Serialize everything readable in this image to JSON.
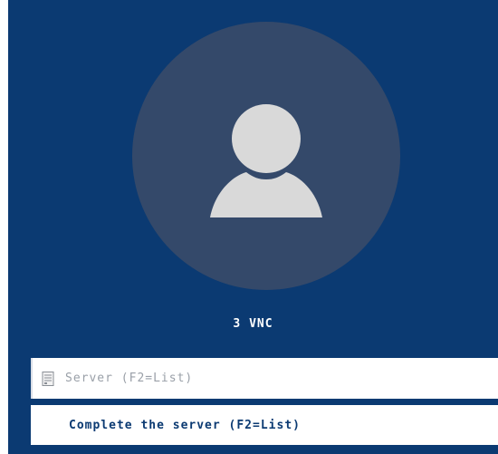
{
  "session": {
    "name": "3 VNC"
  },
  "server": {
    "placeholder": "Server (F2=List)",
    "value": "",
    "icon": "server-icon"
  },
  "hint": {
    "text": "Complete the server (F2=List)"
  },
  "colors": {
    "background": "#0b3a72",
    "avatar_circle": "#34496a",
    "avatar_figure": "#d9d9d9",
    "hint_text": "#0b3a72"
  }
}
